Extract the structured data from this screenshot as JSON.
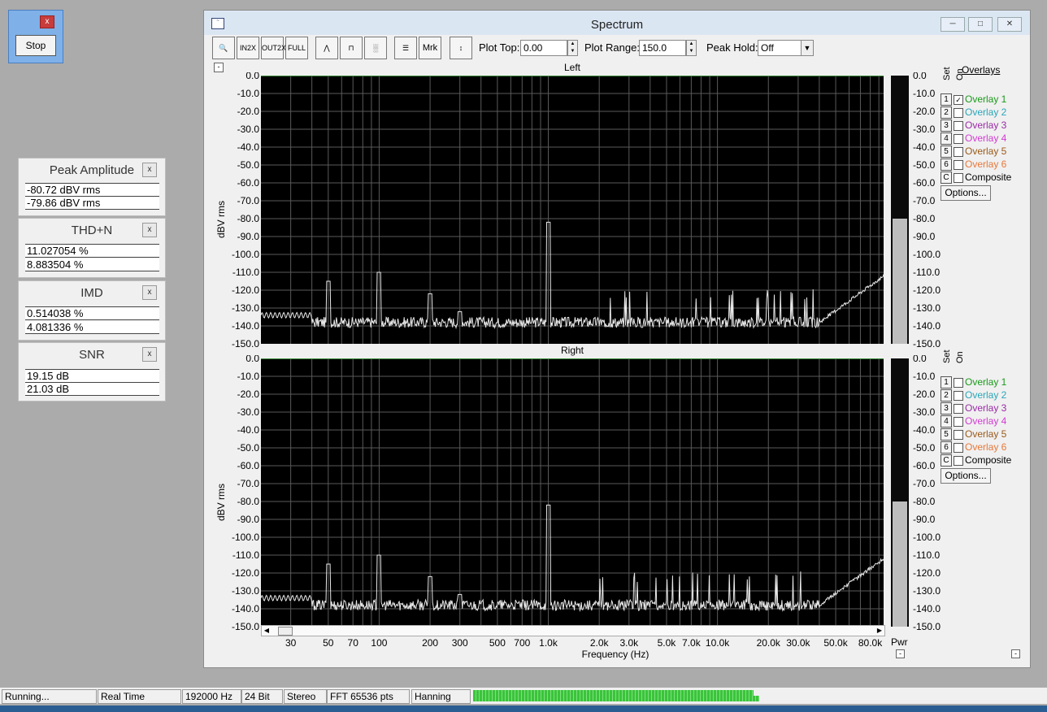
{
  "stop_panel": {
    "close_label": "x",
    "stop_label": "Stop"
  },
  "meters": [
    {
      "title": "Peak Amplitude",
      "close": "x",
      "values": [
        "-80.72 dBV rms",
        "-79.86 dBV rms"
      ]
    },
    {
      "title": "THD+N",
      "close": "x",
      "values": [
        "11.027054 %",
        "8.883504 %"
      ]
    },
    {
      "title": "IMD",
      "close": "x",
      "values": [
        "0.514038 %",
        "4.081336 %"
      ]
    },
    {
      "title": "SNR",
      "close": "x",
      "values": [
        "19.15 dB",
        "21.03 dB"
      ]
    }
  ],
  "spectrum": {
    "title": "Spectrum",
    "toolbar": {
      "plot_top_label": "Plot Top:",
      "plot_top_value": "0.00",
      "plot_range_label": "Plot Range:",
      "plot_range_value": "150.0",
      "peak_hold_label": "Peak Hold:",
      "peak_hold_value": "Off",
      "mrk_label": "Mrk"
    },
    "plots": [
      {
        "channel": "Left",
        "level_db": -80
      },
      {
        "channel": "Right",
        "level_db": -80
      }
    ],
    "y_axis_label": "dBV rms",
    "y_ticks": [
      "0.0",
      "-10.0",
      "-20.0",
      "-30.0",
      "-40.0",
      "-50.0",
      "-60.0",
      "-70.0",
      "-80.0",
      "-90.0",
      "-100.0",
      "-110.0",
      "-120.0",
      "-130.0",
      "-140.0",
      "-150.0"
    ],
    "x_ticks": [
      "30",
      "50",
      "70",
      "100",
      "200",
      "300",
      "500",
      "700",
      "1.0k",
      "2.0k",
      "3.0k",
      "5.0k",
      "7.0k",
      "10.0k",
      "20.0k",
      "30.0k",
      "50.0k",
      "80.0k"
    ],
    "x_axis_label": "Frequency (Hz)",
    "pwr_label": "Pwr",
    "overlays": {
      "title": "Overlays",
      "set_label": "Set",
      "on_label": "On",
      "items": [
        {
          "set": "1",
          "label": "Overlay 1",
          "color": "#1a9a1a"
        },
        {
          "set": "2",
          "label": "Overlay 2",
          "color": "#2aa6b8"
        },
        {
          "set": "3",
          "label": "Overlay 3",
          "color": "#9a2aa6"
        },
        {
          "set": "4",
          "label": "Overlay 4",
          "color": "#d23ad2"
        },
        {
          "set": "5",
          "label": "Overlay 5",
          "color": "#9a5a1a"
        },
        {
          "set": "6",
          "label": "Overlay 6",
          "color": "#e8783a"
        },
        {
          "set": "C",
          "label": "Composite",
          "color": "#000000"
        }
      ],
      "left_checked": [
        true,
        false,
        false,
        false,
        false,
        false,
        false
      ],
      "options_label": "Options..."
    }
  },
  "status_bar": [
    "Running...",
    "Real Time",
    "192000 Hz",
    "24 Bit",
    "Stereo",
    "FFT 65536 pts",
    "Hanning"
  ]
}
